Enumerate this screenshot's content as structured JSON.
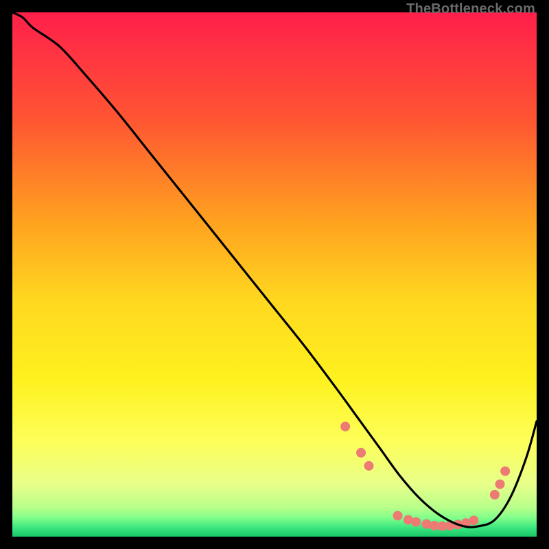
{
  "watermark": "TheBottleneck.com",
  "chart_data": {
    "type": "line",
    "title": "",
    "xlabel": "",
    "ylabel": "",
    "xlim": [
      0,
      100
    ],
    "ylim": [
      0,
      100
    ],
    "grid": false,
    "legend": false,
    "background_gradient": {
      "stops": [
        {
          "offset": 0.0,
          "color": "#ff1f4b"
        },
        {
          "offset": 0.2,
          "color": "#ff5433"
        },
        {
          "offset": 0.4,
          "color": "#ffa21f"
        },
        {
          "offset": 0.55,
          "color": "#ffd81f"
        },
        {
          "offset": 0.7,
          "color": "#fff11f"
        },
        {
          "offset": 0.82,
          "color": "#fdff5a"
        },
        {
          "offset": 0.9,
          "color": "#e8ff8a"
        },
        {
          "offset": 0.945,
          "color": "#b6ff8a"
        },
        {
          "offset": 0.965,
          "color": "#7dff8a"
        },
        {
          "offset": 0.985,
          "color": "#35e27d"
        },
        {
          "offset": 1.0,
          "color": "#18c768"
        }
      ]
    },
    "series": [
      {
        "name": "curve",
        "color": "#000000",
        "x": [
          0,
          2,
          4,
          9,
          14,
          20,
          26,
          32,
          38,
          44,
          50,
          56,
          62,
          66,
          70,
          74,
          78,
          82,
          86,
          89,
          92,
          95,
          98,
          100
        ],
        "y": [
          100,
          99,
          97,
          93.5,
          88,
          81,
          73.5,
          66,
          58.5,
          51,
          43.5,
          36,
          28,
          22.5,
          17,
          11.5,
          7,
          3.8,
          2,
          2,
          3.2,
          7.5,
          15,
          22
        ]
      }
    ],
    "markers": {
      "color": "#ee7a74",
      "radius_px": 7,
      "points": [
        {
          "x": 63.5,
          "y": 21.0
        },
        {
          "x": 66.5,
          "y": 16.0
        },
        {
          "x": 68.0,
          "y": 13.5
        },
        {
          "x": 73.5,
          "y": 4.0
        },
        {
          "x": 75.5,
          "y": 3.2
        },
        {
          "x": 77.0,
          "y": 2.8
        },
        {
          "x": 79.0,
          "y": 2.4
        },
        {
          "x": 80.5,
          "y": 2.1
        },
        {
          "x": 82.0,
          "y": 2.0
        },
        {
          "x": 83.5,
          "y": 2.1
        },
        {
          "x": 85.0,
          "y": 2.3
        },
        {
          "x": 86.5,
          "y": 2.6
        },
        {
          "x": 88.0,
          "y": 3.1
        },
        {
          "x": 92.0,
          "y": 8.0
        },
        {
          "x": 93.0,
          "y": 10.0
        },
        {
          "x": 94.0,
          "y": 12.5
        }
      ]
    }
  }
}
